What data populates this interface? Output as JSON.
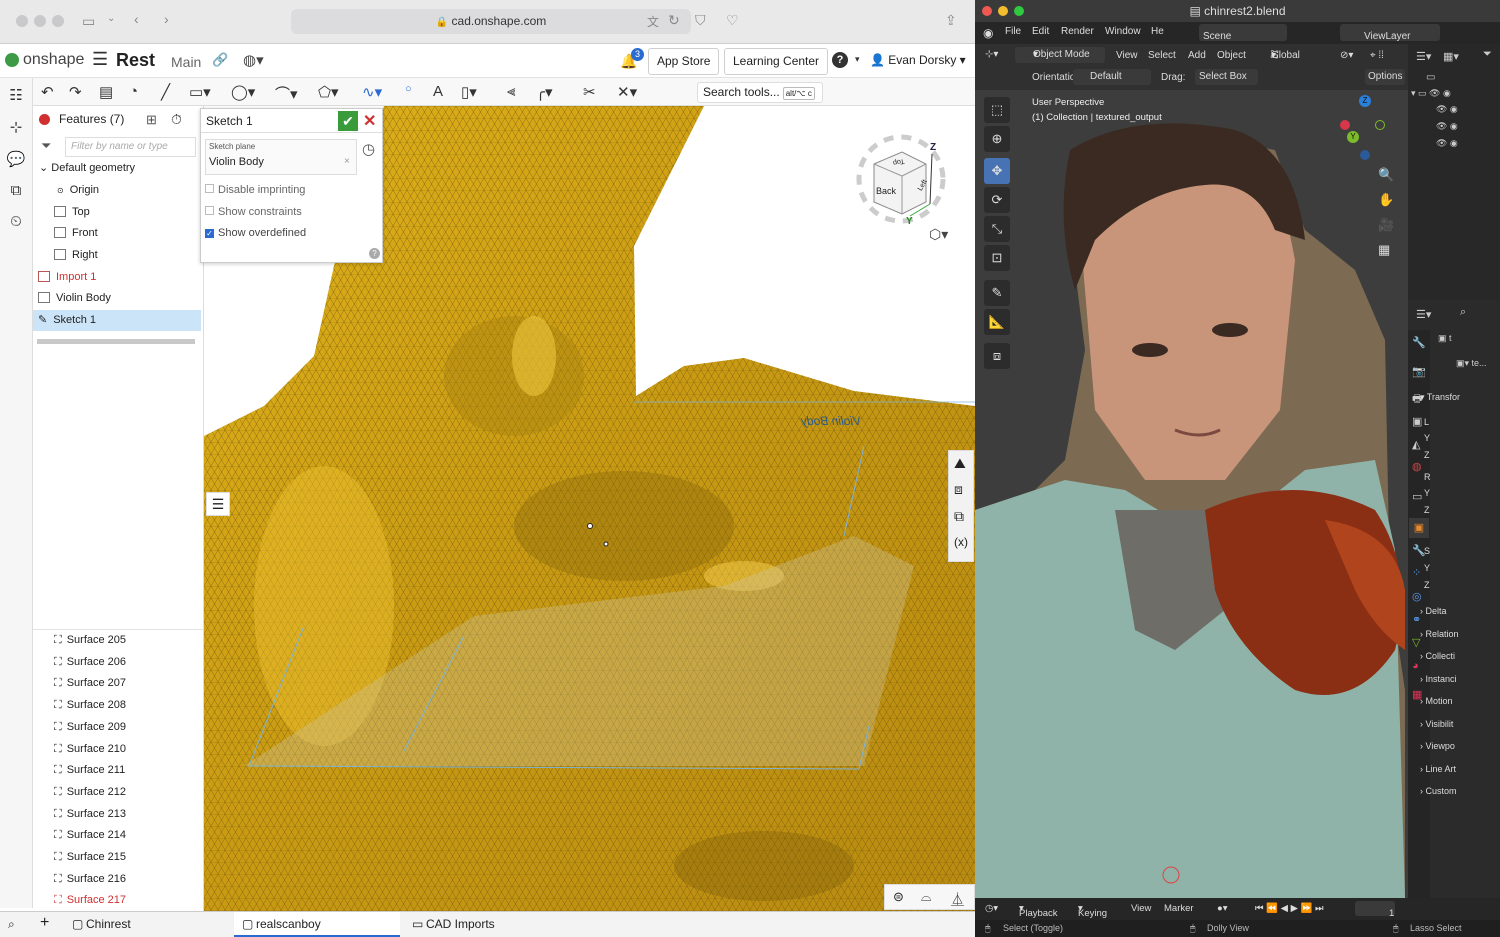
{
  "safari": {
    "url": "cad.onshape.com",
    "tab_count_badge": "3"
  },
  "onshape": {
    "logo": "onshape",
    "document_name": "Rest",
    "branch": "Main",
    "app_store": "App Store",
    "learning_center": "Learning Center",
    "help": "?",
    "user": "Evan Dorsky",
    "search_tools": "Search tools...",
    "search_shortcut": "alt/⌥ c",
    "features_header": "Features (7)",
    "filter_placeholder": "Filter by name or type",
    "tree": [
      {
        "label": "Default geometry",
        "kind": "group"
      },
      {
        "label": "Origin",
        "kind": "origin"
      },
      {
        "label": "Top",
        "kind": "plane"
      },
      {
        "label": "Front",
        "kind": "plane"
      },
      {
        "label": "Right",
        "kind": "plane"
      },
      {
        "label": "Import 1",
        "kind": "import",
        "error": true
      },
      {
        "label": "Violin Body",
        "kind": "part"
      },
      {
        "label": "Sketch 1",
        "kind": "sketch",
        "selected": true
      }
    ],
    "surfaces": [
      {
        "label": "Surface 205"
      },
      {
        "label": "Surface 206"
      },
      {
        "label": "Surface 207"
      },
      {
        "label": "Surface 208"
      },
      {
        "label": "Surface 209"
      },
      {
        "label": "Surface 210"
      },
      {
        "label": "Surface 211"
      },
      {
        "label": "Surface 212"
      },
      {
        "label": "Surface 213"
      },
      {
        "label": "Surface 214"
      },
      {
        "label": "Surface 215"
      },
      {
        "label": "Surface 216"
      },
      {
        "label": "Surface 217",
        "error": true
      }
    ],
    "sketch_dialog": {
      "title": "Sketch 1",
      "plane_label": "Sketch plane",
      "plane_value": "Violin Body",
      "opt1": "Disable imprinting",
      "opt2": "Show constraints",
      "opt3": "Show overdefined",
      "help": "?"
    },
    "viewcube": {
      "face_front": "Back",
      "face_side": "Left",
      "face_top": "Top",
      "axis_z": "Z",
      "axis_y": "Y",
      "axis_x": "X"
    },
    "canvas_label": "Violin Body",
    "bottom_tabs": [
      {
        "label": "Chinrest"
      },
      {
        "label": "realscanboy",
        "active": true
      },
      {
        "label": "CAD Imports"
      }
    ]
  },
  "blender": {
    "title": "chinrest2.blend",
    "menu": [
      "File",
      "Edit",
      "Render",
      "Window",
      "He"
    ],
    "scene": "Scene",
    "view_layer": "ViewLayer",
    "mode": "Object Mode",
    "header_menu": [
      "View",
      "Select",
      "Add",
      "Object"
    ],
    "transform_orientation": "Global",
    "orientation_label": "Orientation:",
    "orientation_value": "Default",
    "drag_label": "Drag:",
    "drag_value": "Select Box",
    "options": "Options",
    "viewport_title": "User Perspective",
    "viewport_collection": "(1) Collection | textured_output",
    "props_field1": "t",
    "props_field2": "te...",
    "transform_panel": "Transfor",
    "loc": [
      "L",
      "Y",
      "Z"
    ],
    "rot": [
      "R",
      "Y",
      "Z"
    ],
    "scale": [
      "S",
      "Y",
      "Z"
    ],
    "sections": [
      "Delta",
      "Relation",
      "Collecti",
      "Instanci",
      "Motion",
      "Visibilit",
      "Viewpo",
      "Line Art",
      "Custom"
    ],
    "timeline": [
      "Playback",
      "Keying",
      "View",
      "Marker"
    ],
    "frame": "1",
    "status": [
      "Select (Toggle)",
      "Dolly View",
      "Lasso Select"
    ]
  }
}
